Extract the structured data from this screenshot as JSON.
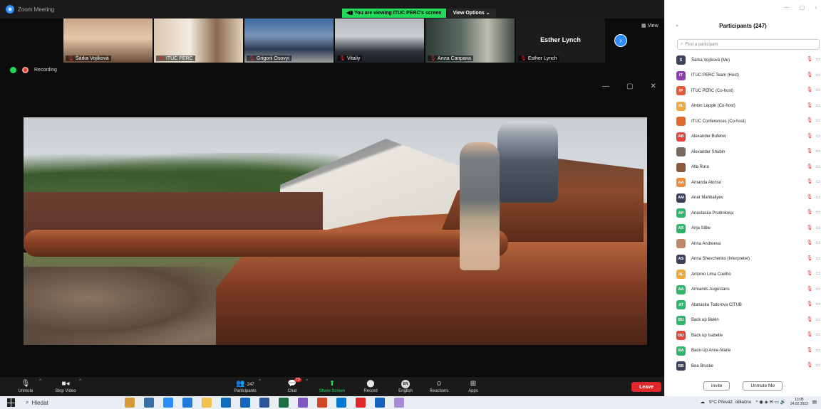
{
  "window": {
    "title": "Zoom Meeting",
    "share_banner": "You are viewing ITUC PERC's screen",
    "view_options": "View Options",
    "view_button": "View",
    "recording_label": "Recording"
  },
  "thumbnails": [
    {
      "name": "Šárka Vojíková"
    },
    {
      "name": "ITUC PERC"
    },
    {
      "name": "Grigorii Osovyi"
    },
    {
      "name": "Vitaliy"
    },
    {
      "name": "Алла Сапрана"
    },
    {
      "name": "Esther Lynch",
      "big_name": "Esther Lynch"
    }
  ],
  "toolbar": {
    "unmute": "Unmute",
    "stop_video": "Stop Video",
    "participants": "Participants",
    "participants_count": "247",
    "chat": "Chat",
    "chat_badge": "73",
    "share_screen": "Share Screen",
    "record": "Record",
    "english": "English",
    "lang_badge": "EN",
    "reactions": "Reactions",
    "apps": "Apps",
    "leave": "Leave"
  },
  "panel": {
    "title": "Participants (247)",
    "search_placeholder": "Find a participant",
    "invite": "Invite",
    "unmute_me": "Unmute Me"
  },
  "participants": [
    {
      "initials": "Š",
      "name": "Šárka Vojíková (Me)",
      "color": "#3a3f5a"
    },
    {
      "initials": "IT",
      "name": "ITUC-PERC Team (Host)",
      "color": "#8e3fb3"
    },
    {
      "initials": "IP",
      "name": "ITUC PERC (Co-host)",
      "color": "#e05a3c"
    },
    {
      "initials": "AL",
      "name": "Anton Leppik (Co-host)",
      "color": "#f2a93b"
    },
    {
      "initials": "",
      "name": "ITUC Conferences (Co-host)",
      "color": "#e06a2a"
    },
    {
      "initials": "AB",
      "name": "Alexander Bufetov",
      "color": "#e0483c"
    },
    {
      "initials": "",
      "name": "Alexander Shubin",
      "color": "#7a6a5e"
    },
    {
      "initials": "",
      "name": "Alla Rura",
      "color": "#8a5a3e"
    },
    {
      "initials": "AA",
      "name": "Amanda Alonso",
      "color": "#f28a3b"
    },
    {
      "initials": "AM",
      "name": "Anar Mahbaliyev",
      "color": "#3a3f5a"
    },
    {
      "initials": "AP",
      "name": "Anastasiia Prudnikova",
      "color": "#2fb56c"
    },
    {
      "initials": "AS",
      "name": "Anja Silbe",
      "color": "#2fb56c"
    },
    {
      "initials": "",
      "name": "Anna Andreeva",
      "color": "#c08a6a"
    },
    {
      "initials": "AS",
      "name": "Anna Shevchenko (Interpreter)",
      "color": "#3a3f5a"
    },
    {
      "initials": "AL",
      "name": "Antonio Lima Coelho",
      "color": "#f2a93b"
    },
    {
      "initials": "AA",
      "name": "Armands Augustans",
      "color": "#2fb56c"
    },
    {
      "initials": "AT",
      "name": "Atanaska Todorova CITUB",
      "color": "#2fb56c"
    },
    {
      "initials": "BU",
      "name": "Back up Belén",
      "color": "#2fb56c"
    },
    {
      "initials": "BU",
      "name": "Back up Isabelle",
      "color": "#e0483c"
    },
    {
      "initials": "BA",
      "name": "Back-Up Anne-Marie",
      "color": "#2fb56c"
    },
    {
      "initials": "BB",
      "name": "Bea Bruske",
      "color": "#3a3f5a"
    }
  ],
  "taskbar": {
    "search": "Hledat",
    "weather": "9°C Převáž. oblačno",
    "time": "13:05",
    "date": "24.02.2023"
  }
}
